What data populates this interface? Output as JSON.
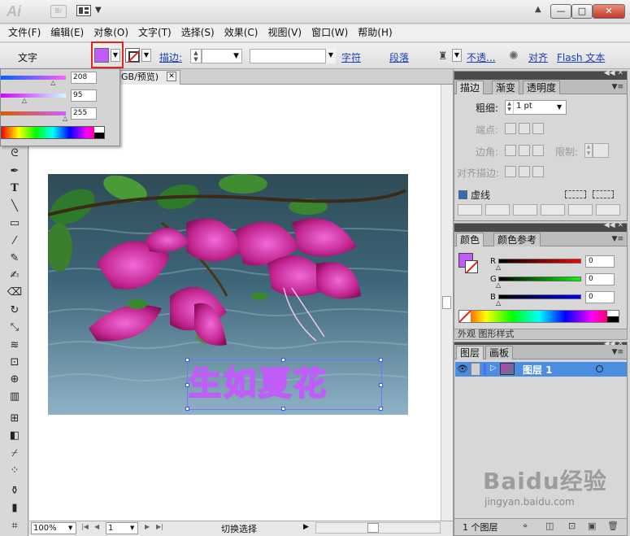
{
  "app": {
    "logo": "Ai",
    "bridge": "Br",
    "window_buttons": {
      "minimize": "—",
      "maximize": "□",
      "close": "✕"
    }
  },
  "menu": [
    "文件(F)",
    "编辑(E)",
    "对象(O)",
    "文字(T)",
    "选择(S)",
    "效果(C)",
    "视图(V)",
    "窗口(W)",
    "帮助(H)"
  ],
  "control_bar": {
    "label": "文字",
    "fill_color": "#c05cf8",
    "stroke_label": "描边:",
    "character_link": "字符",
    "paragraph_link": "段落",
    "opacity_link": "不透...",
    "align_link": "对齐",
    "flash_text_link": "Flash 文本"
  },
  "color_popup": {
    "r_value": "208",
    "g_value": "95",
    "b_value": "255",
    "r_fraction": 0.816,
    "g_fraction": 0.373,
    "b_fraction": 1.0
  },
  "document": {
    "tab_title": "GB/预览)",
    "tab_close": "✕"
  },
  "artwork": {
    "text": "生如夏花",
    "accent": "#c05cf8"
  },
  "status_bar": {
    "zoom": "100%",
    "page": "1",
    "status_text": "切换选择"
  },
  "stroke_panel": {
    "tabs": [
      "描边",
      "渐变",
      "透明度"
    ],
    "weight_label": "粗细:",
    "weight_value": "1 pt",
    "cap_label": "端点:",
    "join_label": "边角:",
    "limit_label": "限制:",
    "align_label": "对齐描边:",
    "dashed_label": "虚线"
  },
  "color_panel": {
    "tabs": [
      "颜色",
      "颜色参考"
    ],
    "r_label": "R",
    "g_label": "G",
    "b_label": "B",
    "r_value": "0",
    "g_value": "0",
    "b_value": "0"
  },
  "ghost_tabs": "外观   图形样式",
  "layers_panel": {
    "tabs": [
      "图层",
      "画板"
    ],
    "layer_name": "图层 1",
    "count": "1 个图层"
  },
  "watermark": {
    "main": "Baidu经验",
    "sub": "jingyan.baidu.com"
  }
}
